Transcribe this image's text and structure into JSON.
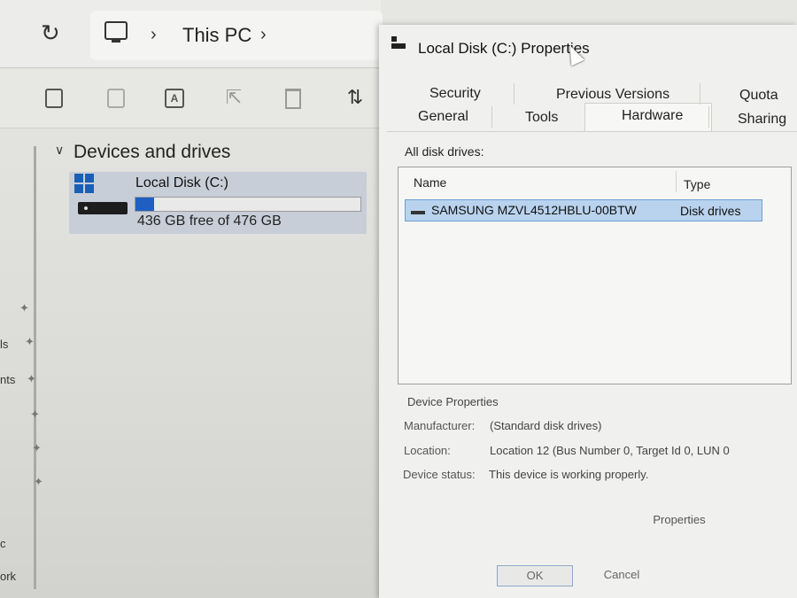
{
  "explorer": {
    "breadcrumb": {
      "location": "This PC"
    },
    "section_title": "Devices and drives",
    "drive": {
      "name": "Local Disk (C:)",
      "free_text": "436 GB free of 476 GB",
      "used_fraction": 0.084
    },
    "nav_fragments": [
      "ls",
      "nts",
      "c",
      "ork"
    ]
  },
  "dialog": {
    "title": "Local Disk (C:) Properties",
    "tabs": {
      "security": "Security",
      "previous_versions": "Previous Versions",
      "quota": "Quota",
      "general": "General",
      "tools": "Tools",
      "hardware": "Hardware",
      "sharing": "Sharing"
    },
    "active_tab": "Hardware",
    "all_drives_label": "All disk drives:",
    "columns": {
      "name": "Name",
      "type": "Type"
    },
    "rows": [
      {
        "name": "SAMSUNG MZVL4512HBLU-00BTW",
        "type": "Disk drives"
      }
    ],
    "device_properties": {
      "title": "Device Properties",
      "manufacturer_label": "Manufacturer:",
      "manufacturer_value": "(Standard disk drives)",
      "location_label": "Location:",
      "location_value": "Location 12 (Bus Number 0, Target Id 0, LUN 0",
      "status_label": "Device status:",
      "status_value": "This device is working properly."
    },
    "buttons": {
      "properties": "Properties",
      "ok": "OK",
      "cancel": "Cancel"
    }
  },
  "colors": {
    "selection": "#b9d3ee",
    "drive_bar": "#1f5fc4",
    "windows_logo": "#1a5fb4"
  }
}
